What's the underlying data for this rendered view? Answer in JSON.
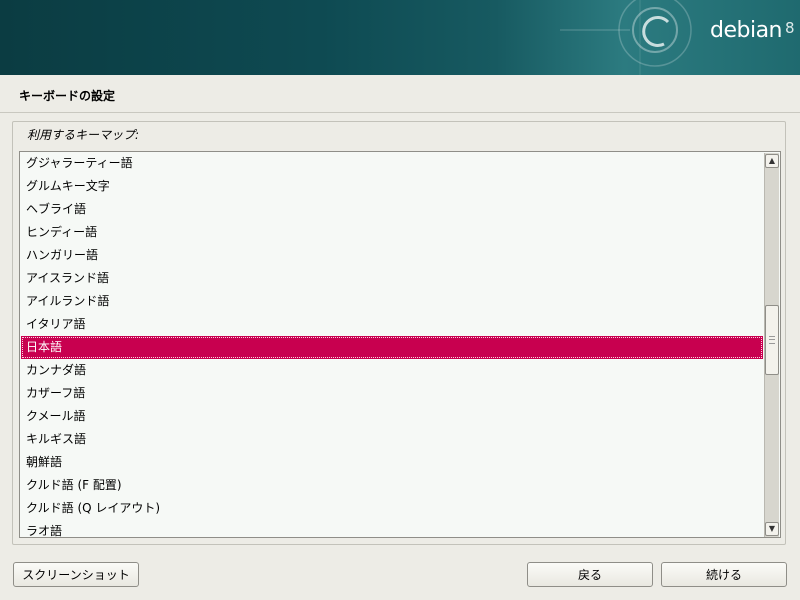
{
  "banner": {
    "brand_name": "debian",
    "brand_version": "8"
  },
  "page": {
    "title": "キーボードの設定"
  },
  "keymap": {
    "label": "利用するキーマップ:",
    "selected_index": 8,
    "items": [
      "グジャラーティー語",
      "グルムキー文字",
      "ヘブライ語",
      "ヒンディー語",
      "ハンガリー語",
      "アイスランド語",
      "アイルランド語",
      "イタリア語",
      "日本語",
      "カンナダ語",
      "カザーフ語",
      "クメール語",
      "キルギス語",
      "朝鮮語",
      "クルド語 (F 配置)",
      "クルド語 (Q レイアウト)",
      "ラオ語"
    ]
  },
  "buttons": {
    "screenshot": "スクリーンショット",
    "back": "戻る",
    "continue": "続ける"
  },
  "colors": {
    "selection": "#c8004f",
    "banner": "#0e4a52"
  }
}
